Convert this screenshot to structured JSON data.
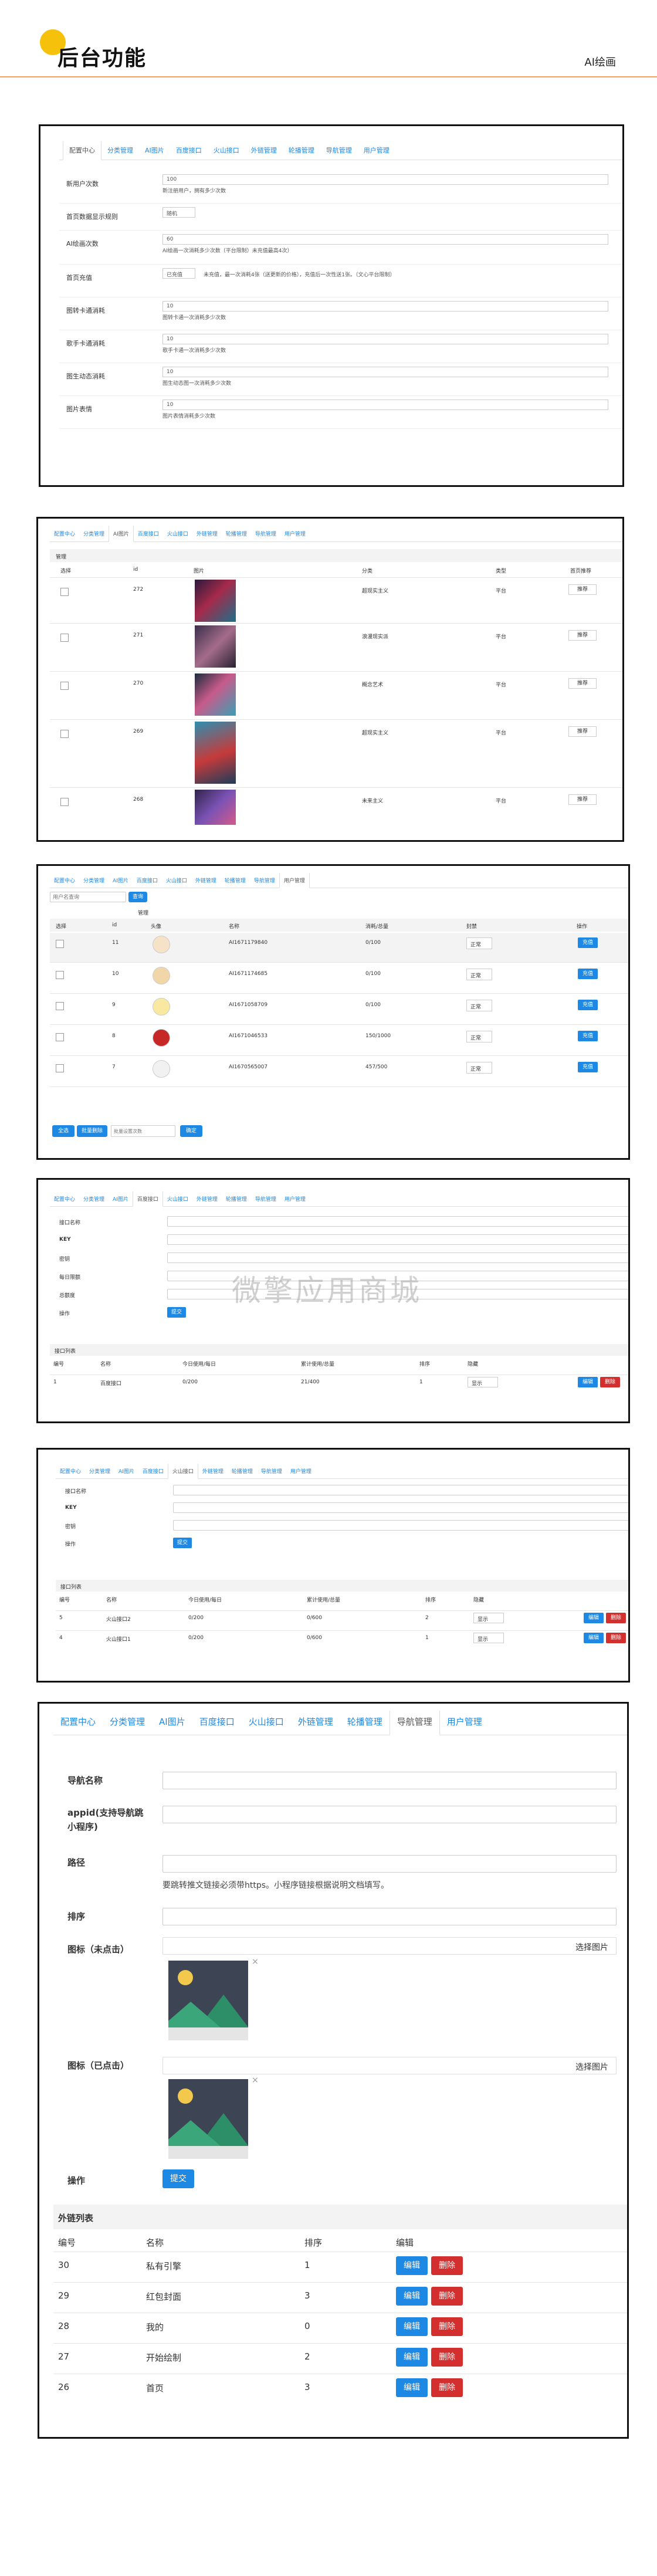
{
  "header": {
    "title": "后台功能",
    "right": "AI绘画"
  },
  "watermark": "微擎应用商城",
  "s1": {
    "tabs": [
      "配置中心",
      "分类管理",
      "AI图片",
      "百度接口",
      "火山接口",
      "外链管理",
      "轮播管理",
      "导航管理",
      "用户管理"
    ],
    "fields": [
      {
        "label": "新用户次数",
        "value": "100",
        "hint": "新注册用户，拥有多少次数"
      },
      {
        "label": "首页数据显示规则",
        "value": "随机",
        "hint": ""
      },
      {
        "label": "AI绘画次数",
        "value": "60",
        "hint": "AI绘画一次消耗多少次数（平台限制）未充值最高4次）"
      },
      {
        "label": "首页充值",
        "value": "已充值",
        "hint": "未充值，最一次消耗4张（送更新的价格），充值后一次性送1张。（文心平台限制）"
      },
      {
        "label": "图转卡通消耗",
        "value": "10",
        "hint": "图转卡通一次消耗多少次数"
      },
      {
        "label": "歌手卡通消耗",
        "value": "10",
        "hint": "歌手卡通一次消耗多少次数"
      },
      {
        "label": "图生动态消耗",
        "value": "10",
        "hint": "图生动态图一次消耗多少次数"
      },
      {
        "label": "图片表情",
        "value": "10",
        "hint": "图片表情消耗多少次数"
      }
    ]
  },
  "s2": {
    "tabs": [
      "配置中心",
      "分类管理",
      "AI图片",
      "百度接口",
      "火山接口",
      "外链管理",
      "轮播管理",
      "导航管理",
      "用户管理"
    ],
    "section": "管理",
    "columns": [
      "选择",
      "id",
      "图片",
      "分类",
      "类型",
      "首页推荐"
    ],
    "rows": [
      {
        "id": "272",
        "cat": "超现实主义",
        "type": "平台",
        "action": "推荐"
      },
      {
        "id": "271",
        "cat": "浪漫现实派",
        "type": "平台",
        "action": "推荐"
      },
      {
        "id": "270",
        "cat": "概念艺术",
        "type": "平台",
        "action": "推荐"
      },
      {
        "id": "269",
        "cat": "超现实主义",
        "type": "平台",
        "action": "推荐"
      },
      {
        "id": "268",
        "cat": "未来主义",
        "type": "平台",
        "action": "推荐"
      }
    ]
  },
  "s3": {
    "tabs": [
      "配置中心",
      "分类管理",
      "AI图片",
      "百度接口",
      "火山接口",
      "外链管理",
      "轮播管理",
      "导航管理",
      "用户管理"
    ],
    "search_placeholder": "用户名查询",
    "search_btn": "查询",
    "section": "管理",
    "columns": [
      "选择",
      "id",
      "头像",
      "名称",
      "消耗/总量",
      "封禁",
      "操作"
    ],
    "rows": [
      {
        "id": "11",
        "name": "AI1671179840",
        "usage": "0/100",
        "status": "正常",
        "action": "充值"
      },
      {
        "id": "10",
        "name": "AI1671174685",
        "usage": "0/100",
        "status": "正常",
        "action": "充值"
      },
      {
        "id": "9",
        "name": "AI1671058709",
        "usage": "0/100",
        "status": "正常",
        "action": "充值"
      },
      {
        "id": "8",
        "name": "AI1671046533",
        "usage": "150/1000",
        "status": "正常",
        "action": "充值"
      },
      {
        "id": "7",
        "name": "AI1670565007",
        "usage": "457/500",
        "status": "正常",
        "action": "充值"
      }
    ],
    "footer": {
      "all": "全选",
      "batch": "批量删除",
      "input_placeholder": "批量设置次数",
      "btn": "确定"
    }
  },
  "s4": {
    "tabs": [
      "配置中心",
      "分类管理",
      "AI图片",
      "百度接口",
      "火山接口",
      "外链管理",
      "轮播管理",
      "导航管理",
      "用户管理"
    ],
    "labels": [
      "接口名称",
      "KEY",
      "密钥",
      "每日限额",
      "总额度",
      "操作"
    ],
    "submit": "提交",
    "list_title": "接口列表",
    "columns": [
      "编号",
      "名称",
      "今日使用/每日",
      "累计使用/总量",
      "排序",
      "隐藏"
    ],
    "rows": [
      {
        "no": "1",
        "name": "百度接口",
        "today": "0/200",
        "total": "21/400",
        "sort": "1",
        "hidden": "显示"
      }
    ],
    "edit": "编辑",
    "del": "删除"
  },
  "s5": {
    "tabs": [
      "配置中心",
      "分类管理",
      "AI图片",
      "百度接口",
      "火山接口",
      "外链管理",
      "轮播管理",
      "导航管理",
      "用户管理"
    ],
    "labels": [
      "接口名称",
      "KEY",
      "密钥",
      "操作"
    ],
    "submit": "提交",
    "list_title": "接口列表",
    "columns": [
      "编号",
      "名称",
      "今日使用/每日",
      "累计使用/总量",
      "排序",
      "隐藏"
    ],
    "rows": [
      {
        "no": "5",
        "name": "火山接口2",
        "today": "0/200",
        "total": "0/600",
        "sort": "2",
        "hidden": "显示"
      },
      {
        "no": "4",
        "name": "火山接口1",
        "today": "0/200",
        "total": "0/600",
        "sort": "1",
        "hidden": "显示"
      }
    ],
    "edit": "编辑",
    "del": "删除"
  },
  "s6": {
    "tabs": [
      "配置中心",
      "分类管理",
      "AI图片",
      "百度接口",
      "火山接口",
      "外链管理",
      "轮播管理",
      "导航管理",
      "用户管理"
    ],
    "labels": {
      "name": "导航名称",
      "appid": "appid(支持导航跳小程序)",
      "path": "路径",
      "sort": "排序",
      "icon_off": "图标（未点击）",
      "icon_on": "图标（已点击）",
      "action": "操作"
    },
    "path_hint": "要跳转推文链接必须带https。小程序链接根据说明文档填写。",
    "choose_img": "选择图片",
    "submit": "提交",
    "list_title": "外链列表",
    "columns": [
      "编号",
      "名称",
      "排序",
      "编辑"
    ],
    "rows": [
      {
        "no": "30",
        "name": "私有引擎",
        "sort": "1"
      },
      {
        "no": "29",
        "name": "红包封面",
        "sort": "3"
      },
      {
        "no": "28",
        "name": "我的",
        "sort": "0"
      },
      {
        "no": "27",
        "name": "开始绘制",
        "sort": "2"
      },
      {
        "no": "26",
        "name": "首页",
        "sort": "3"
      }
    ],
    "edit": "编辑",
    "del": "删除"
  },
  "colors": {
    "accent": "#1e88e5",
    "danger": "#d32f2f",
    "brand": "#f5c10b",
    "header_line": "#f1a261"
  }
}
